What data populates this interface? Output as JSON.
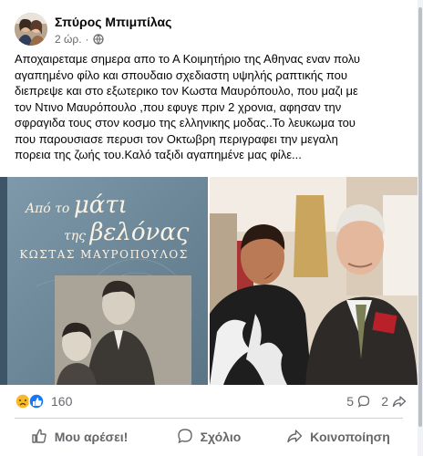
{
  "author": {
    "name": "Σπύρος Μπιμπίλας"
  },
  "meta": {
    "time": "2 ώρ.",
    "separator": "·"
  },
  "post": {
    "lines": [
      "Αποχαιρεταμε σημερα απο το Α Κοιμητήριο της Αθηνας εναν πολυ",
      "αγαπημένο φίλο και σπουδαιο σχεδιαστη υψηλής ραπτικής που",
      "διεπρεψε και στο εξωτερικο τον Κωστα Μαυρόπουλο, που μαζι με",
      "τον Ντινο Μαυρόπουλο ,που εφυγε πριν 2 χρονια, αφησαν την",
      "σφραγιδα τους στον κοσμο της ελληνικης μοδας..Το λευκωμα του",
      "που παρουσιασε περυσι τον Οκτωβρη περιγραφει την μεγαλη",
      "πορεια της ζωής του.Καλό ταξιδι αγαπημένε μας φίλε..."
    ]
  },
  "cover": {
    "line1": "Από το",
    "line1_big": "μάτι",
    "line2": "της",
    "line2_big": "βελόνας",
    "author": "ΚΩΣΤΑΣ ΜΑΥΡΟΠΟΥΛΟΣ"
  },
  "reactions": {
    "count": "160",
    "comments": "5",
    "shares": "2"
  },
  "actions": {
    "like": "Μου αρέσει!",
    "comment": "Σχόλιο",
    "share": "Κοινοποίηση"
  },
  "icons": {
    "globe": "globe-icon",
    "like": "thumbs-up-icon",
    "comment": "speech-bubble-icon",
    "share": "share-arrow-icon"
  },
  "colors": {
    "like_blue": "#1877f2",
    "sad_yellow": "#f7b928",
    "text_gray": "#65676b"
  }
}
